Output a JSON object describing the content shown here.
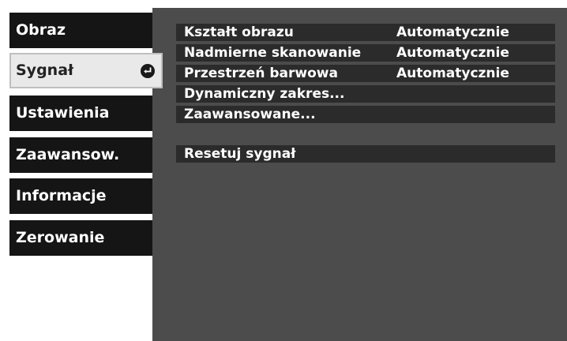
{
  "sidebar": {
    "items": [
      {
        "label": "Obraz"
      },
      {
        "label": "Sygnał"
      },
      {
        "label": "Ustawienia"
      },
      {
        "label": "Zaawansow."
      },
      {
        "label": "Informacje"
      },
      {
        "label": "Zerowanie"
      }
    ],
    "active_index": 1,
    "active_icon": "return-arrow-icon"
  },
  "menu": {
    "rows": [
      {
        "label": "Kształt obrazu",
        "value": "Automatycznie"
      },
      {
        "label": "Nadmierne skanowanie",
        "value": "Automatycznie"
      },
      {
        "label": "Przestrzeń barwowa",
        "value": "Automatycznie"
      },
      {
        "label": "Dynamiczny zakres...",
        "value": ""
      },
      {
        "label": "Zaawansowane...",
        "value": ""
      }
    ],
    "reset": {
      "label": "Resetuj sygnał"
    }
  },
  "colors": {
    "panel": "#4c4c4c",
    "tab": "#151515",
    "tab_active": "#e9e9e9",
    "row": "#2b2b2b"
  }
}
